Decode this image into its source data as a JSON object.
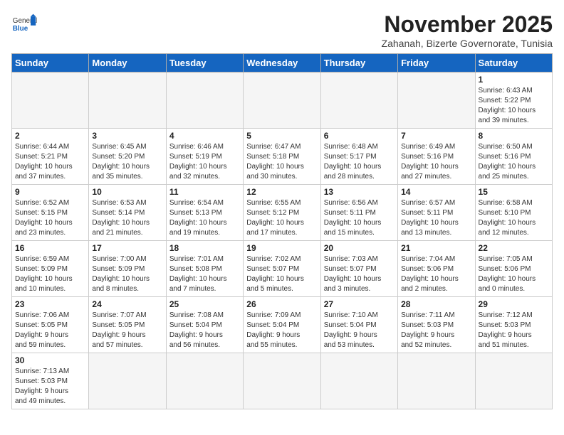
{
  "header": {
    "logo_general": "General",
    "logo_blue": "Blue",
    "month_title": "November 2025",
    "subtitle": "Zahanah, Bizerte Governorate, Tunisia"
  },
  "weekdays": [
    "Sunday",
    "Monday",
    "Tuesday",
    "Wednesday",
    "Thursday",
    "Friday",
    "Saturday"
  ],
  "rows": [
    [
      {
        "day": "",
        "info": ""
      },
      {
        "day": "",
        "info": ""
      },
      {
        "day": "",
        "info": ""
      },
      {
        "day": "",
        "info": ""
      },
      {
        "day": "",
        "info": ""
      },
      {
        "day": "",
        "info": ""
      },
      {
        "day": "1",
        "info": "Sunrise: 6:43 AM\nSunset: 5:22 PM\nDaylight: 10 hours\nand 39 minutes."
      }
    ],
    [
      {
        "day": "2",
        "info": "Sunrise: 6:44 AM\nSunset: 5:21 PM\nDaylight: 10 hours\nand 37 minutes."
      },
      {
        "day": "3",
        "info": "Sunrise: 6:45 AM\nSunset: 5:20 PM\nDaylight: 10 hours\nand 35 minutes."
      },
      {
        "day": "4",
        "info": "Sunrise: 6:46 AM\nSunset: 5:19 PM\nDaylight: 10 hours\nand 32 minutes."
      },
      {
        "day": "5",
        "info": "Sunrise: 6:47 AM\nSunset: 5:18 PM\nDaylight: 10 hours\nand 30 minutes."
      },
      {
        "day": "6",
        "info": "Sunrise: 6:48 AM\nSunset: 5:17 PM\nDaylight: 10 hours\nand 28 minutes."
      },
      {
        "day": "7",
        "info": "Sunrise: 6:49 AM\nSunset: 5:16 PM\nDaylight: 10 hours\nand 27 minutes."
      },
      {
        "day": "8",
        "info": "Sunrise: 6:50 AM\nSunset: 5:16 PM\nDaylight: 10 hours\nand 25 minutes."
      }
    ],
    [
      {
        "day": "9",
        "info": "Sunrise: 6:52 AM\nSunset: 5:15 PM\nDaylight: 10 hours\nand 23 minutes."
      },
      {
        "day": "10",
        "info": "Sunrise: 6:53 AM\nSunset: 5:14 PM\nDaylight: 10 hours\nand 21 minutes."
      },
      {
        "day": "11",
        "info": "Sunrise: 6:54 AM\nSunset: 5:13 PM\nDaylight: 10 hours\nand 19 minutes."
      },
      {
        "day": "12",
        "info": "Sunrise: 6:55 AM\nSunset: 5:12 PM\nDaylight: 10 hours\nand 17 minutes."
      },
      {
        "day": "13",
        "info": "Sunrise: 6:56 AM\nSunset: 5:11 PM\nDaylight: 10 hours\nand 15 minutes."
      },
      {
        "day": "14",
        "info": "Sunrise: 6:57 AM\nSunset: 5:11 PM\nDaylight: 10 hours\nand 13 minutes."
      },
      {
        "day": "15",
        "info": "Sunrise: 6:58 AM\nSunset: 5:10 PM\nDaylight: 10 hours\nand 12 minutes."
      }
    ],
    [
      {
        "day": "16",
        "info": "Sunrise: 6:59 AM\nSunset: 5:09 PM\nDaylight: 10 hours\nand 10 minutes."
      },
      {
        "day": "17",
        "info": "Sunrise: 7:00 AM\nSunset: 5:09 PM\nDaylight: 10 hours\nand 8 minutes."
      },
      {
        "day": "18",
        "info": "Sunrise: 7:01 AM\nSunset: 5:08 PM\nDaylight: 10 hours\nand 7 minutes."
      },
      {
        "day": "19",
        "info": "Sunrise: 7:02 AM\nSunset: 5:07 PM\nDaylight: 10 hours\nand 5 minutes."
      },
      {
        "day": "20",
        "info": "Sunrise: 7:03 AM\nSunset: 5:07 PM\nDaylight: 10 hours\nand 3 minutes."
      },
      {
        "day": "21",
        "info": "Sunrise: 7:04 AM\nSunset: 5:06 PM\nDaylight: 10 hours\nand 2 minutes."
      },
      {
        "day": "22",
        "info": "Sunrise: 7:05 AM\nSunset: 5:06 PM\nDaylight: 10 hours\nand 0 minutes."
      }
    ],
    [
      {
        "day": "23",
        "info": "Sunrise: 7:06 AM\nSunset: 5:05 PM\nDaylight: 9 hours\nand 59 minutes."
      },
      {
        "day": "24",
        "info": "Sunrise: 7:07 AM\nSunset: 5:05 PM\nDaylight: 9 hours\nand 57 minutes."
      },
      {
        "day": "25",
        "info": "Sunrise: 7:08 AM\nSunset: 5:04 PM\nDaylight: 9 hours\nand 56 minutes."
      },
      {
        "day": "26",
        "info": "Sunrise: 7:09 AM\nSunset: 5:04 PM\nDaylight: 9 hours\nand 55 minutes."
      },
      {
        "day": "27",
        "info": "Sunrise: 7:10 AM\nSunset: 5:04 PM\nDaylight: 9 hours\nand 53 minutes."
      },
      {
        "day": "28",
        "info": "Sunrise: 7:11 AM\nSunset: 5:03 PM\nDaylight: 9 hours\nand 52 minutes."
      },
      {
        "day": "29",
        "info": "Sunrise: 7:12 AM\nSunset: 5:03 PM\nDaylight: 9 hours\nand 51 minutes."
      }
    ],
    [
      {
        "day": "30",
        "info": "Sunrise: 7:13 AM\nSunset: 5:03 PM\nDaylight: 9 hours\nand 49 minutes."
      },
      {
        "day": "",
        "info": ""
      },
      {
        "day": "",
        "info": ""
      },
      {
        "day": "",
        "info": ""
      },
      {
        "day": "",
        "info": ""
      },
      {
        "day": "",
        "info": ""
      },
      {
        "day": "",
        "info": ""
      }
    ]
  ]
}
